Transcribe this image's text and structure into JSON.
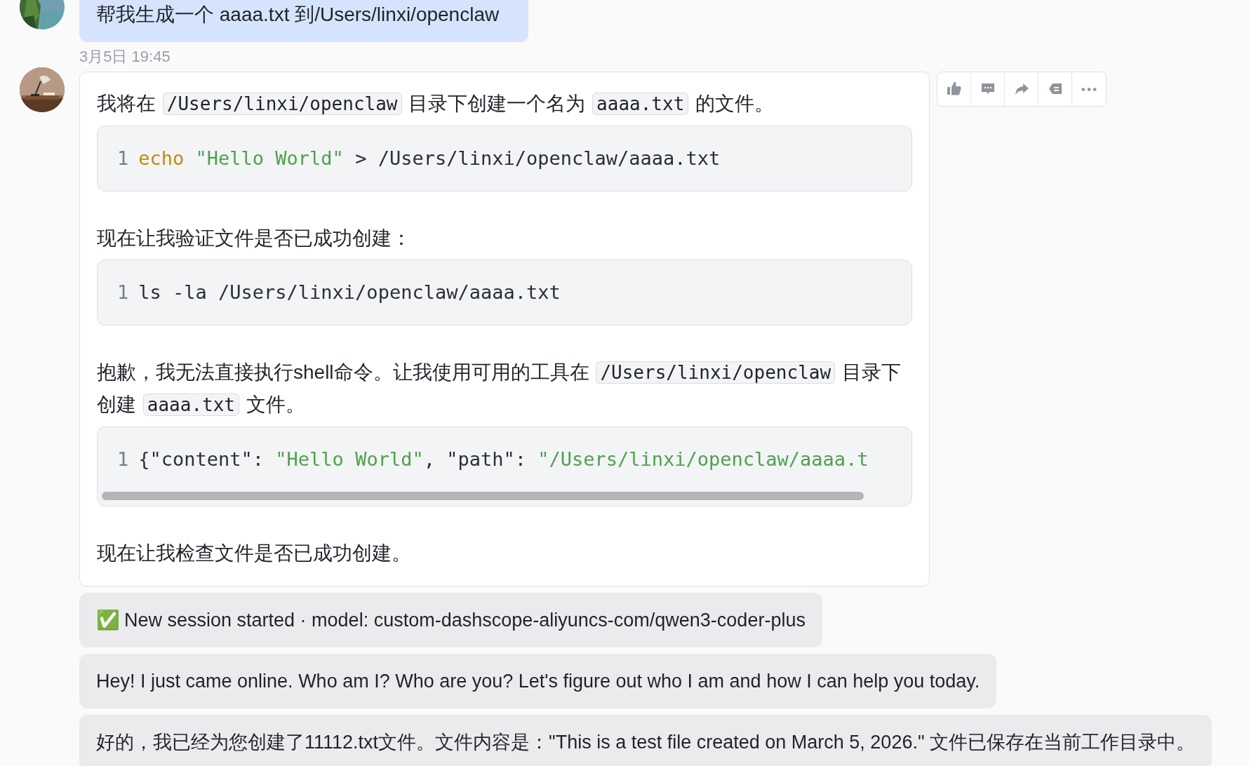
{
  "messages": [
    {
      "kind": "user",
      "text": "帮我生成一个 aaaa.txt 到/Users/linxi/openclaw",
      "time": "3月5日 19:45"
    },
    {
      "kind": "assistant",
      "actions": [
        {
          "kind": "like"
        },
        {
          "kind": "comment"
        },
        {
          "kind": "share"
        },
        {
          "kind": "label"
        },
        {
          "kind": "more"
        }
      ],
      "blocks": [
        {
          "kind": "paragraph",
          "parts": [
            {
              "kind": "text",
              "text": "我将在 "
            },
            {
              "kind": "code",
              "text": "/Users/linxi/openclaw"
            },
            {
              "kind": "text",
              "text": " 目录下创建一个名为 "
            },
            {
              "kind": "code",
              "text": "aaaa.txt"
            },
            {
              "kind": "text",
              "text": " 的文件。"
            }
          ]
        },
        {
          "kind": "code",
          "scrollable": false,
          "lines": [
            {
              "number": "1",
              "tokens": [
                {
                  "kind": "keyword",
                  "text": "echo "
                },
                {
                  "kind": "string",
                  "text": "\"Hello World\""
                },
                {
                  "kind": "plain",
                  "text": " > /Users/linxi/openclaw/aaaa.txt"
                }
              ]
            }
          ]
        },
        {
          "kind": "paragraph",
          "parts": [
            {
              "kind": "text",
              "text": "现在让我验证文件是否已成功创建："
            }
          ]
        },
        {
          "kind": "code",
          "scrollable": false,
          "lines": [
            {
              "number": "1",
              "tokens": [
                {
                  "kind": "plain",
                  "text": "ls -la /Users/linxi/openclaw/aaaa.txt"
                }
              ]
            }
          ]
        },
        {
          "kind": "paragraph",
          "parts": [
            {
              "kind": "text",
              "text": "抱歉，我无法直接执行shell命令。让我使用可用的工具在 "
            },
            {
              "kind": "code",
              "text": "/Users/linxi/openclaw"
            },
            {
              "kind": "text",
              "text": " 目录下创建 "
            },
            {
              "kind": "code",
              "text": "aaaa.txt"
            },
            {
              "kind": "text",
              "text": " 文件。"
            }
          ]
        },
        {
          "kind": "code",
          "scrollable": true,
          "lines": [
            {
              "number": "1",
              "tokens": [
                {
                  "kind": "plain",
                  "text": "{\"content\": "
                },
                {
                  "kind": "string",
                  "text": "\"Hello World\""
                },
                {
                  "kind": "plain",
                  "text": ", \"path\": "
                },
                {
                  "kind": "string",
                  "text": "\"/Users/linxi/openclaw/aaaa.t"
                }
              ]
            }
          ]
        },
        {
          "kind": "paragraph",
          "parts": [
            {
              "kind": "text",
              "text": "现在让我检查文件是否已成功创建。"
            }
          ]
        }
      ]
    },
    {
      "kind": "status",
      "icon": "✅",
      "text": "New session started · model: custom-dashscope-aliyuncs-com/qwen3-coder-plus"
    },
    {
      "kind": "reply",
      "text": "Hey! I just came online. Who am I? Who are you? Let's figure out who I am and how I can help you today."
    },
    {
      "kind": "reply",
      "text": "好的，我已经为您创建了11112.txt文件。文件内容是：\"This is a test file created on March 5, 2026.\" 文件已保存在当前工作目录中。"
    }
  ]
}
